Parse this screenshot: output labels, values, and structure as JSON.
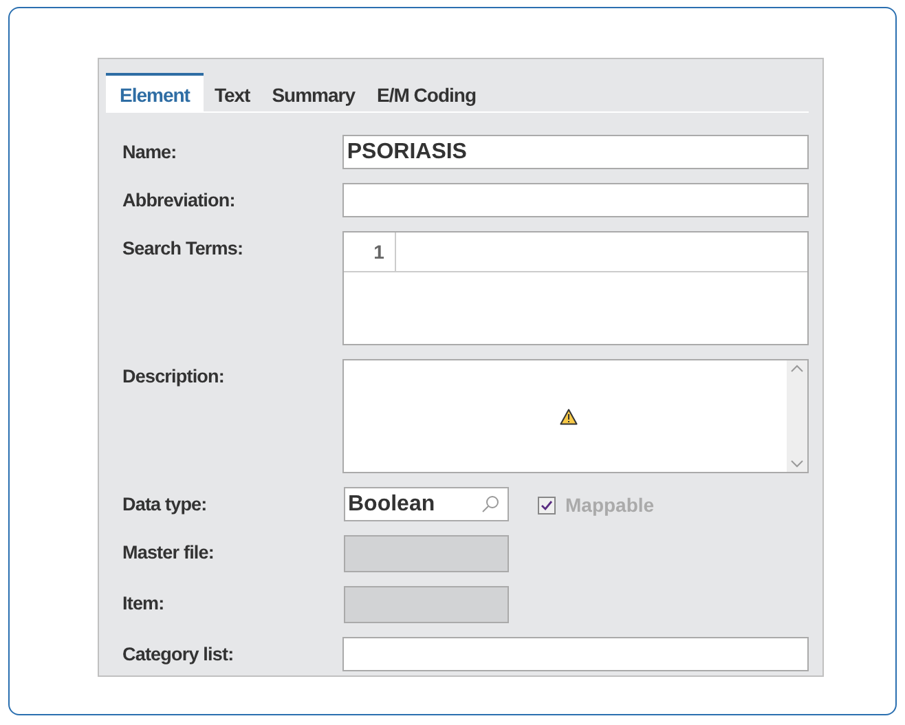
{
  "tabs": [
    {
      "label": "Element",
      "selected": true
    },
    {
      "label": "Text",
      "selected": false
    },
    {
      "label": "Summary",
      "selected": false
    },
    {
      "label": "E/M Coding",
      "selected": false
    }
  ],
  "fields": [
    {
      "kind": "text",
      "label": "Name:",
      "value": "PSORIASIS"
    },
    {
      "kind": "text",
      "label": "Abbreviation:"
    },
    {
      "kind": "grid",
      "label": "Search Terms:",
      "line_number": "1"
    },
    {
      "kind": "memo",
      "label": "Description:",
      "warning": true
    },
    {
      "kind": "lookup",
      "label": "Data type:",
      "value": "Boolean",
      "checkbox": {
        "label": "Mappable",
        "checked": true,
        "disabled": true
      }
    },
    {
      "kind": "disabled",
      "label": "Master file:"
    },
    {
      "kind": "disabled",
      "label": "Item:"
    },
    {
      "kind": "text",
      "label": "Category list:"
    }
  ]
}
